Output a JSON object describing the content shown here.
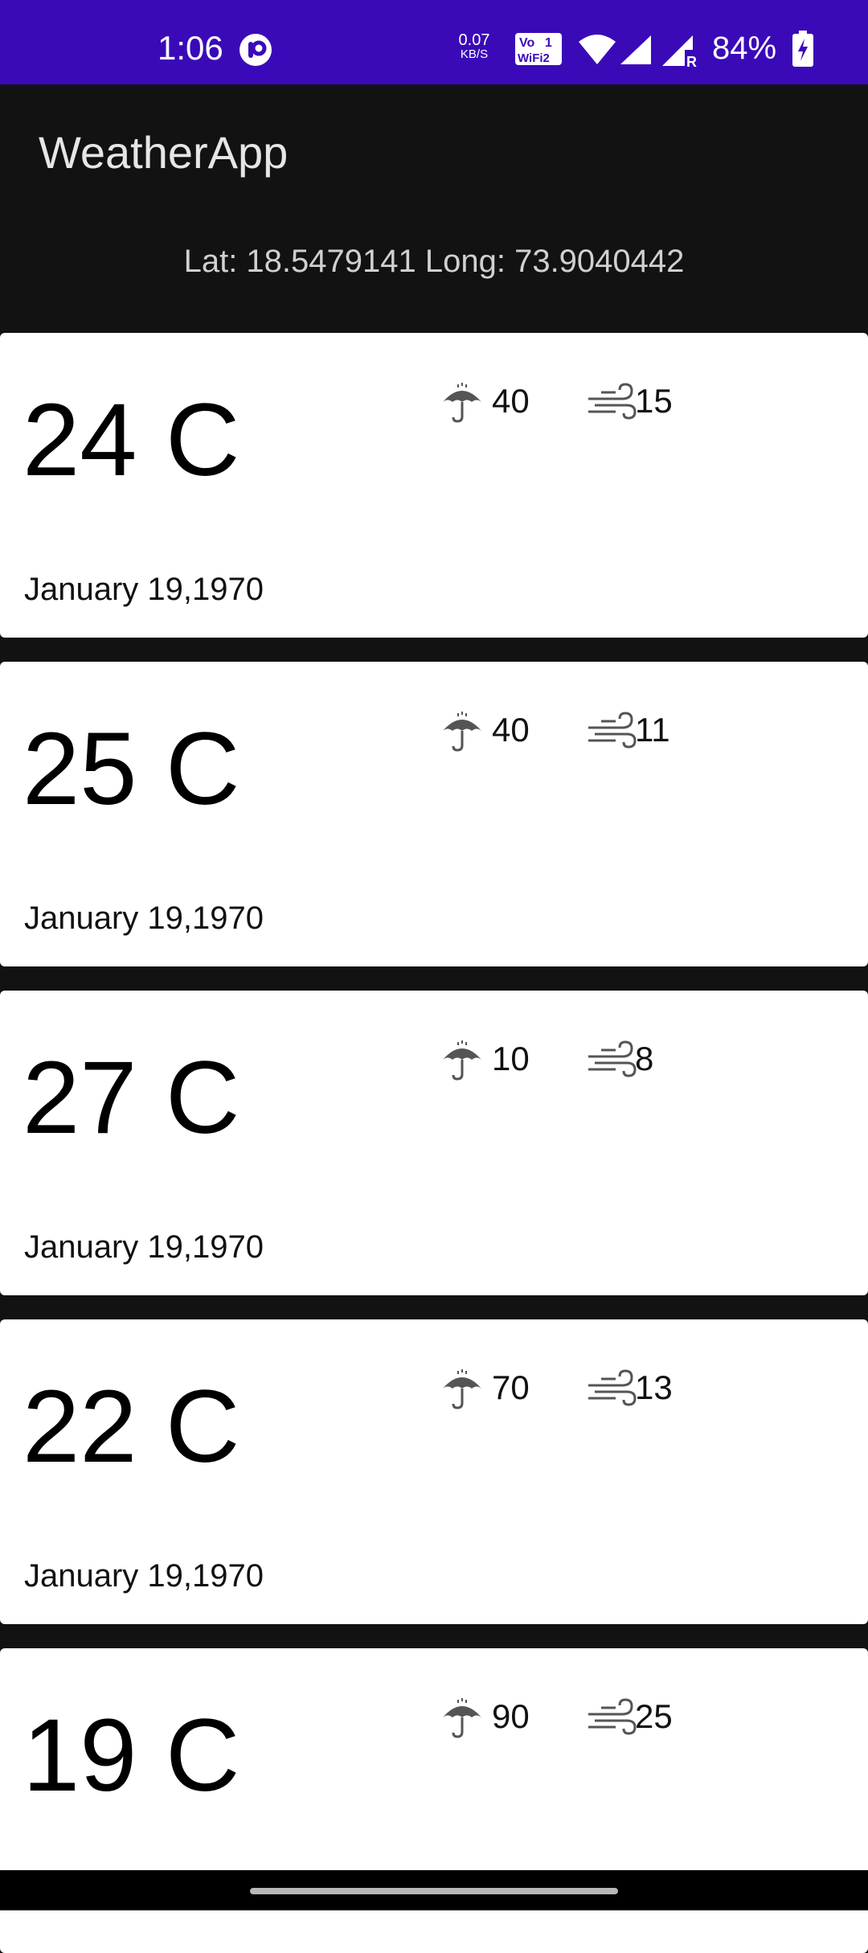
{
  "status_bar": {
    "time": "1:06",
    "net_speed_value": "0.07",
    "net_speed_unit": "KB/S",
    "volte_label": "Vo",
    "wifi_label": "WiFi 2",
    "battery_percent": "84%"
  },
  "app": {
    "title": "WeatherApp",
    "coordinates": "Lat: 18.5479141 Long: 73.9040442"
  },
  "forecasts": [
    {
      "temperature": "24 C",
      "rain": "40",
      "wind": "15",
      "date": "January 19,1970"
    },
    {
      "temperature": "25 C",
      "rain": "40",
      "wind": "11",
      "date": "January 19,1970"
    },
    {
      "temperature": "27 C",
      "rain": "10",
      "wind": "8",
      "date": "January 19,1970"
    },
    {
      "temperature": "22 C",
      "rain": "70",
      "wind": "13",
      "date": "January 19,1970"
    },
    {
      "temperature": "19 C",
      "rain": "90",
      "wind": "25",
      "date": ""
    }
  ],
  "icons": {
    "umbrella": "umbrella-icon",
    "wind": "wind-icon"
  },
  "colors": {
    "status_bar": "#3a0ab8",
    "background": "#121212",
    "card": "#ffffff"
  }
}
